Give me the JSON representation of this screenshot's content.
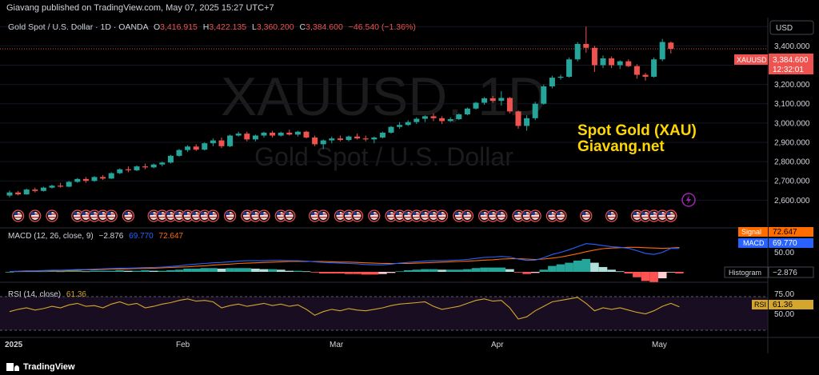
{
  "header": {
    "published": "Giavang published on TradingView.com, May 07, 2025 15:27 UTC+7"
  },
  "legend": {
    "title": "Gold Spot / U.S. Dollar · 1D · OANDA",
    "o_label": "O",
    "o_value": "3,416.915",
    "h_label": "H",
    "h_value": "3,422.135",
    "l_label": "L",
    "l_value": "3,360.200",
    "c_label": "C",
    "c_value": "3,384.600",
    "change": "−46.540 (−1.36%)"
  },
  "watermark": {
    "symbol": "XAUUSD, 1D",
    "name": "Gold Spot / U.S. Dollar"
  },
  "overlay_text": {
    "line1": "Spot Gold (XAU)",
    "line2": "Giavang.net"
  },
  "price_axis": {
    "currency": "USD",
    "symbol_tag": "XAUUSD",
    "last_price": "3,384.600",
    "countdown": "12:32:01"
  },
  "macd": {
    "label": "MACD (12, 26, close, 9)",
    "v1": "−2.876",
    "v2": "69.770",
    "v3": "72.647",
    "signal_tag": "Signal",
    "signal_value": "72.647",
    "macd_tag": "MACD",
    "macd_value": "69.770",
    "hist_tag": "Histogram",
    "hist_value": "−2.876",
    "axis_label": "50.00"
  },
  "rsi": {
    "label": "RSI (14, close)",
    "value": "61.36",
    "tag": "RSI",
    "tag_value": "61.36",
    "axis_labels": [
      "75.00",
      "50.00"
    ]
  },
  "time_axis": [
    "2025",
    "Feb",
    "Mar",
    "Apr",
    "May"
  ],
  "footer": {
    "brand": "TradingView"
  },
  "colors": {
    "up": "#26a69a",
    "down": "#ef5350",
    "macd": "#2962ff",
    "signal": "#ff6d00",
    "rsi": "#d4a72c",
    "overlay": "#ffd700"
  },
  "chart_data": {
    "type": "candlestick",
    "y_ticks": [
      2600,
      2700,
      2800,
      2900,
      3000,
      3100,
      3200,
      3300,
      3400,
      3500
    ],
    "ylim": [
      2560,
      3530
    ],
    "candles": [
      [
        2624,
        2650,
        2615,
        2640
      ],
      [
        2640,
        2648,
        2625,
        2630
      ],
      [
        2630,
        2660,
        2628,
        2655
      ],
      [
        2655,
        2665,
        2640,
        2648
      ],
      [
        2648,
        2670,
        2645,
        2665
      ],
      [
        2665,
        2680,
        2660,
        2675
      ],
      [
        2675,
        2690,
        2665,
        2670
      ],
      [
        2670,
        2700,
        2668,
        2695
      ],
      [
        2695,
        2715,
        2690,
        2710
      ],
      [
        2710,
        2720,
        2690,
        2700
      ],
      [
        2700,
        2725,
        2695,
        2720
      ],
      [
        2720,
        2730,
        2705,
        2712
      ],
      [
        2712,
        2745,
        2710,
        2740
      ],
      [
        2740,
        2765,
        2735,
        2760
      ],
      [
        2760,
        2775,
        2745,
        2755
      ],
      [
        2755,
        2780,
        2750,
        2775
      ],
      [
        2775,
        2790,
        2760,
        2770
      ],
      [
        2770,
        2790,
        2765,
        2785
      ],
      [
        2785,
        2800,
        2775,
        2795
      ],
      [
        2795,
        2835,
        2790,
        2830
      ],
      [
        2830,
        2865,
        2825,
        2860
      ],
      [
        2860,
        2885,
        2850,
        2878
      ],
      [
        2878,
        2890,
        2855,
        2862
      ],
      [
        2862,
        2900,
        2858,
        2895
      ],
      [
        2895,
        2920,
        2880,
        2910
      ],
      [
        2910,
        2925,
        2870,
        2880
      ],
      [
        2880,
        2940,
        2875,
        2935
      ],
      [
        2935,
        2955,
        2930,
        2945
      ],
      [
        2945,
        2955,
        2905,
        2915
      ],
      [
        2915,
        2940,
        2905,
        2935
      ],
      [
        2935,
        2955,
        2925,
        2950
      ],
      [
        2950,
        2960,
        2925,
        2935
      ],
      [
        2935,
        2955,
        2930,
        2950
      ],
      [
        2950,
        2965,
        2935,
        2940
      ],
      [
        2940,
        2960,
        2930,
        2955
      ],
      [
        2955,
        2960,
        2920,
        2925
      ],
      [
        2925,
        2935,
        2880,
        2890
      ],
      [
        2890,
        2915,
        2865,
        2910
      ],
      [
        2910,
        2930,
        2895,
        2920
      ],
      [
        2920,
        2935,
        2905,
        2912
      ],
      [
        2912,
        2935,
        2905,
        2930
      ],
      [
        2930,
        2945,
        2915,
        2920
      ],
      [
        2920,
        2935,
        2905,
        2915
      ],
      [
        2915,
        2930,
        2895,
        2925
      ],
      [
        2925,
        2955,
        2920,
        2950
      ],
      [
        2950,
        2985,
        2945,
        2980
      ],
      [
        2980,
        3005,
        2970,
        2990
      ],
      [
        2990,
        3015,
        2985,
        3005
      ],
      [
        3005,
        3030,
        2995,
        3022
      ],
      [
        3022,
        3040,
        3005,
        3035
      ],
      [
        3035,
        3050,
        3010,
        3025
      ],
      [
        3025,
        3035,
        2995,
        3010
      ],
      [
        3010,
        3030,
        3005,
        3020
      ],
      [
        3020,
        3050,
        3015,
        3045
      ],
      [
        3045,
        3080,
        3040,
        3075
      ],
      [
        3075,
        3110,
        3070,
        3105
      ],
      [
        3105,
        3135,
        3095,
        3128
      ],
      [
        3128,
        3140,
        3105,
        3115
      ],
      [
        3115,
        3165,
        3090,
        3130
      ],
      [
        3130,
        3135,
        3050,
        3060
      ],
      [
        3060,
        3065,
        2970,
        2985
      ],
      [
        2985,
        3040,
        2960,
        3025
      ],
      [
        3025,
        3110,
        3015,
        3100
      ],
      [
        3100,
        3200,
        3095,
        3190
      ],
      [
        3190,
        3245,
        3180,
        3235
      ],
      [
        3235,
        3250,
        3225,
        3240
      ],
      [
        3240,
        3340,
        3235,
        3330
      ],
      [
        3330,
        3420,
        3320,
        3410
      ],
      [
        3410,
        3500,
        3365,
        3390
      ],
      [
        3390,
        3400,
        3265,
        3300
      ],
      [
        3300,
        3350,
        3285,
        3335
      ],
      [
        3335,
        3345,
        3285,
        3300
      ],
      [
        3300,
        3325,
        3280,
        3320
      ],
      [
        3320,
        3330,
        3290,
        3295
      ],
      [
        3295,
        3305,
        3230,
        3250
      ],
      [
        3250,
        3260,
        3220,
        3240
      ],
      [
        3240,
        3340,
        3235,
        3330
      ],
      [
        3330,
        3436,
        3320,
        3420
      ],
      [
        3416.915,
        3422.135,
        3360.2,
        3384.6
      ]
    ],
    "macd": [
      1,
      2,
      3,
      3,
      4,
      5,
      5,
      6,
      7,
      7,
      8,
      9,
      10,
      11,
      11,
      12,
      13,
      13,
      14,
      16,
      18,
      21,
      23,
      25,
      27,
      28,
      30,
      32,
      33,
      33,
      33,
      34,
      34,
      33,
      33,
      32,
      30,
      28,
      27,
      26,
      25,
      24,
      22,
      21,
      21,
      23,
      26,
      28,
      30,
      32,
      33,
      33,
      34,
      35,
      37,
      40,
      43,
      44,
      46,
      44,
      38,
      34,
      35,
      42,
      52,
      58,
      66,
      75,
      84,
      82,
      78,
      75,
      73,
      70,
      63,
      55,
      52,
      58,
      70,
      69.77
    ],
    "signal": [
      1,
      1,
      2,
      2,
      3,
      3,
      4,
      4,
      5,
      6,
      6,
      7,
      8,
      8,
      9,
      10,
      10,
      11,
      12,
      13,
      14,
      15,
      17,
      18,
      20,
      22,
      23,
      25,
      26,
      27,
      28,
      29,
      30,
      31,
      31,
      31,
      31,
      31,
      30,
      29,
      29,
      28,
      27,
      26,
      25,
      25,
      25,
      25,
      26,
      27,
      28,
      29,
      30,
      31,
      32,
      33,
      35,
      36,
      38,
      39,
      39,
      38,
      37,
      38,
      41,
      44,
      49,
      54,
      60,
      65,
      69,
      71,
      72,
      73,
      73,
      72,
      71,
      70,
      71,
      72.647
    ],
    "rsi": [
      55,
      58,
      60,
      57,
      59,
      62,
      60,
      64,
      66,
      62,
      63,
      60,
      65,
      68,
      64,
      66,
      60,
      62,
      65,
      67,
      70,
      72,
      69,
      70,
      68,
      60,
      63,
      65,
      62,
      64,
      66,
      63,
      65,
      62,
      64,
      58,
      50,
      55,
      58,
      56,
      59,
      57,
      56,
      58,
      60,
      63,
      65,
      66,
      67,
      68,
      62,
      58,
      60,
      62,
      66,
      70,
      72,
      69,
      70,
      60,
      45,
      48,
      56,
      62,
      68,
      70,
      72,
      74,
      66,
      56,
      60,
      58,
      60,
      57,
      54,
      52,
      56,
      62,
      66,
      61.36
    ],
    "rsi_bands": [
      70,
      30
    ]
  }
}
